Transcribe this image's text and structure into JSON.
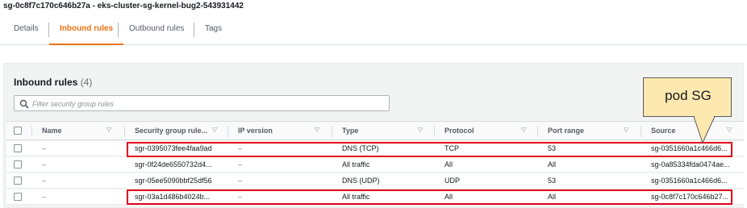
{
  "page": {
    "title": "sg-0c8f7c170c646b27a - eks-cluster-sg-kernel-bug2-543931442"
  },
  "tabs": [
    {
      "label": "Details",
      "active": false
    },
    {
      "label": "Inbound rules",
      "active": true
    },
    {
      "label": "Outbound rules",
      "active": false
    },
    {
      "label": "Tags",
      "active": false
    }
  ],
  "inbound": {
    "title": "Inbound rules",
    "count": "(4)",
    "filter_placeholder": "Filter security group rules",
    "filter_icon": "search-icon",
    "columns": [
      "Name",
      "Security group rule...",
      "IP version",
      "Type",
      "Protocol",
      "Port range",
      "Source"
    ],
    "rows": [
      {
        "name": "–",
        "rule_id": "sgr-0395073fee4faa9ad",
        "ip_version": "–",
        "type": "DNS (TCP)",
        "protocol": "TCP",
        "port_range": "53",
        "source": "sg-0351660a1c466d6...",
        "highlighted": true
      },
      {
        "name": "–",
        "rule_id": "sgr-0f24de6550732d4...",
        "ip_version": "–",
        "type": "All traffic",
        "protocol": "All",
        "port_range": "All",
        "source": "sg-0a85334fda0474ae...",
        "highlighted": false
      },
      {
        "name": "–",
        "rule_id": "sgr-05ee5090bbf25df56",
        "ip_version": "–",
        "type": "DNS (UDP)",
        "protocol": "UDP",
        "port_range": "53",
        "source": "sg-0351660a1c466d6...",
        "highlighted": false
      },
      {
        "name": "–",
        "rule_id": "sgr-03a1d486b4024b...",
        "ip_version": "–",
        "type": "All traffic",
        "protocol": "All",
        "port_range": "All",
        "source": "sg-0c8f7c170c646b27...",
        "highlighted": true
      }
    ]
  },
  "annotation": {
    "callout_text": "pod SG"
  },
  "colors": {
    "accent": "#ec7211",
    "highlight": "#e0001a",
    "callout_fill": "#fde9b0"
  }
}
